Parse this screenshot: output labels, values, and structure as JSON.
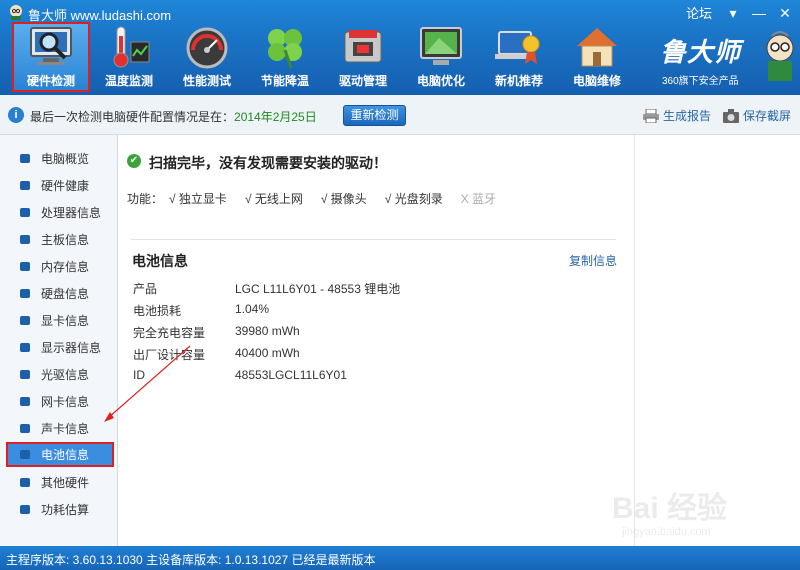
{
  "window": {
    "title": "鲁大师 www.ludashi.com",
    "forum": "论坛"
  },
  "toolbar": {
    "items": [
      {
        "label": "硬件检测",
        "icon": "monitor-magnifier-icon",
        "active": true
      },
      {
        "label": "温度监测",
        "icon": "thermometer-icon"
      },
      {
        "label": "性能测试",
        "icon": "speedometer-icon"
      },
      {
        "label": "节能降温",
        "icon": "clover-icon"
      },
      {
        "label": "驱动管理",
        "icon": "chip-icon"
      },
      {
        "label": "电脑优化",
        "icon": "monitor-broom-icon"
      },
      {
        "label": "新机推荐",
        "icon": "laptop-award-icon"
      },
      {
        "label": "电脑维修",
        "icon": "house-icon"
      }
    ],
    "brand": "鲁大师",
    "brand_sub": "360旗下安全产品"
  },
  "infobar": {
    "text": "最后一次检测电脑硬件配置情况是在：",
    "date": "2014年2月25日",
    "recheck": "重新检测",
    "report": "生成报告",
    "save": "保存截屏"
  },
  "sidebar": {
    "items": [
      {
        "label": "电脑概览"
      },
      {
        "label": "硬件健康"
      },
      {
        "label": "处理器信息"
      },
      {
        "label": "主板信息"
      },
      {
        "label": "内存信息"
      },
      {
        "label": "硬盘信息"
      },
      {
        "label": "显卡信息"
      },
      {
        "label": "显示器信息"
      },
      {
        "label": "光驱信息"
      },
      {
        "label": "网卡信息"
      },
      {
        "label": "声卡信息"
      },
      {
        "label": "电池信息",
        "active": true
      },
      {
        "label": "其他硬件"
      },
      {
        "label": "功耗估算"
      }
    ]
  },
  "main": {
    "scan_title": "扫描完毕，没有发现需要安装的驱动！",
    "features_label": "功能：",
    "features": [
      {
        "label": "√ 独立显卡",
        "enabled": true
      },
      {
        "label": "√ 无线上网",
        "enabled": true
      },
      {
        "label": "√ 摄像头",
        "enabled": true
      },
      {
        "label": "√ 光盘刻录",
        "enabled": true
      },
      {
        "label": "X 蓝牙",
        "enabled": false
      }
    ],
    "section_title": "电池信息",
    "copy": "复制信息",
    "rows": [
      {
        "key": "产品",
        "value": "LGC L11L6Y01 - 48553 锂电池"
      },
      {
        "key": "电池损耗",
        "value": "1.04%"
      },
      {
        "key": "完全充电容量",
        "value": "39980 mWh"
      },
      {
        "key": "出厂设计容量",
        "value": "40400 mWh"
      },
      {
        "key": "ID",
        "value": "48553LGCL11L6Y01"
      }
    ]
  },
  "statusbar": {
    "text": "主程序版本: 3.60.13.1030    主设备库版本: 1.0.13.1027    已经是最新版本"
  },
  "watermark": {
    "main": "Bai 经验",
    "sub": "jingyan.baidu.com"
  },
  "colors": {
    "accent": "#1b74c6",
    "highlight": "#e02020",
    "date": "#1d8a1d",
    "link": "#2a65a8"
  }
}
